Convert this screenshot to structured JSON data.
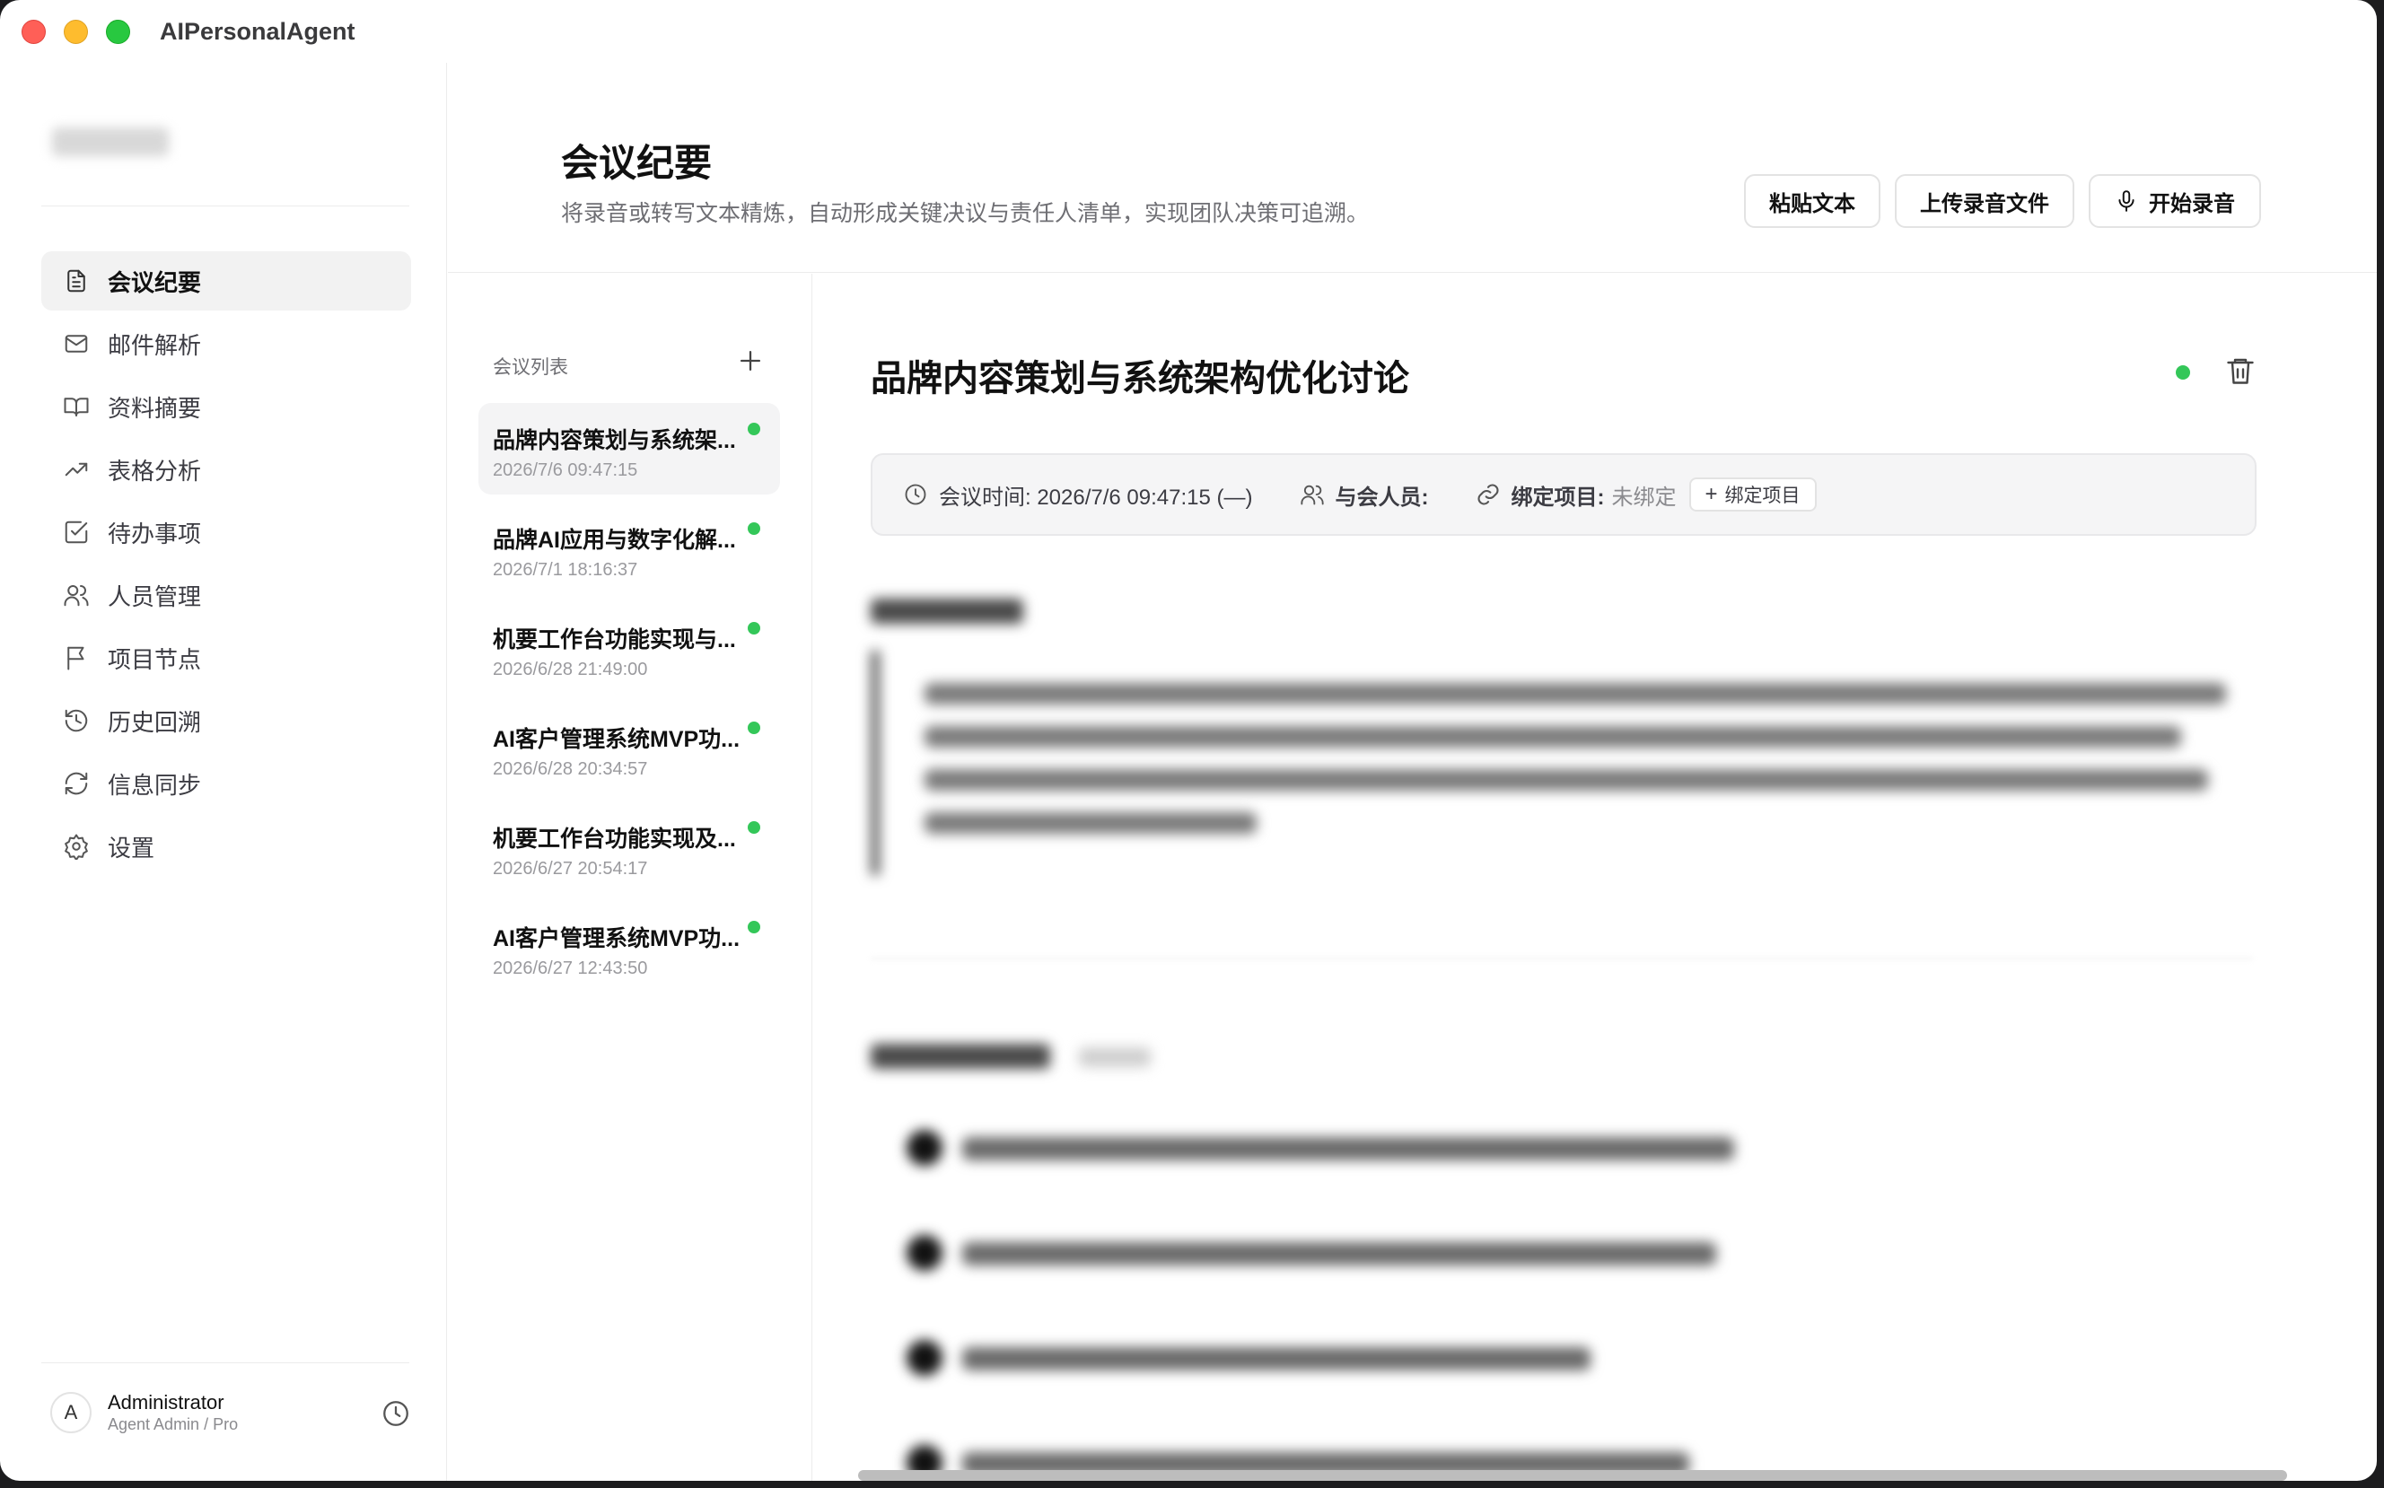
{
  "app": {
    "title": "AIPersonalAgent"
  },
  "sidebar": {
    "items": [
      {
        "label": "会议纪要",
        "icon": "document-icon",
        "active": true
      },
      {
        "label": "邮件解析",
        "icon": "mail-icon"
      },
      {
        "label": "资料摘要",
        "icon": "book-icon"
      },
      {
        "label": "表格分析",
        "icon": "trend-icon"
      },
      {
        "label": "待办事项",
        "icon": "checkbox-icon"
      },
      {
        "label": "人员管理",
        "icon": "users-icon"
      },
      {
        "label": "项目节点",
        "icon": "flag-icon"
      },
      {
        "label": "历史回溯",
        "icon": "history-icon"
      },
      {
        "label": "信息同步",
        "icon": "sync-icon"
      },
      {
        "label": "设置",
        "icon": "gear-icon"
      }
    ],
    "user": {
      "initial": "A",
      "name": "Administrator",
      "role": "Agent Admin / Pro"
    }
  },
  "header": {
    "title": "会议纪要",
    "subtitle": "将录音或转写文本精炼，自动形成关键决议与责任人清单，实现团队决策可追溯。",
    "buttons": {
      "paste": "粘贴文本",
      "upload": "上传录音文件",
      "record": "开始录音"
    }
  },
  "meeting_list": {
    "title": "会议列表",
    "items": [
      {
        "title": "品牌内容策划与系统架...",
        "date": "2026/7/6 09:47:15"
      },
      {
        "title": "品牌AI应用与数字化解...",
        "date": "2026/7/1 18:16:37"
      },
      {
        "title": "机要工作台功能实现与...",
        "date": "2026/6/28 21:49:00"
      },
      {
        "title": "AI客户管理系统MVP功...",
        "date": "2026/6/28 20:34:57"
      },
      {
        "title": "机要工作台功能实现及...",
        "date": "2026/6/27 20:54:17"
      },
      {
        "title": "AI客户管理系统MVP功...",
        "date": "2026/6/27 12:43:50"
      }
    ]
  },
  "detail": {
    "title": "品牌内容策划与系统架构优化讨论",
    "time_text": "会议时间: 2026/7/6 09:47:15 (—)",
    "attendees_label": "与会人员:",
    "project_label": "绑定项目:",
    "project_value": "未绑定",
    "bind_button": "绑定项目"
  },
  "colors": {
    "status_green": "#34c759",
    "active_bg": "#f2f2f2"
  }
}
